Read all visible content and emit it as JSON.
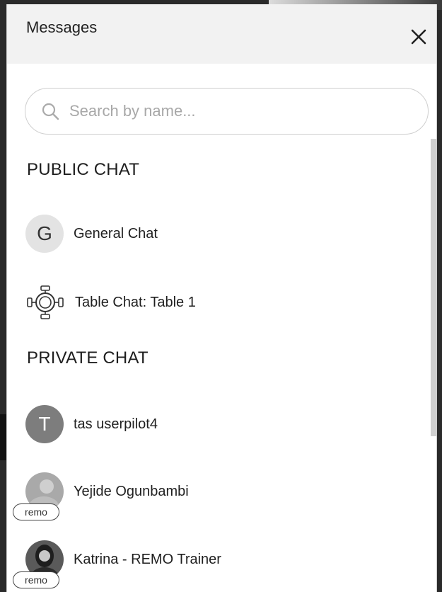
{
  "header": {
    "title": "Messages"
  },
  "search": {
    "placeholder": "Search by name..."
  },
  "public_section": {
    "title": "PUBLIC CHAT",
    "items": [
      {
        "label": "General Chat",
        "avatar_letter": "G",
        "icon": "letter-avatar"
      },
      {
        "label": "Table Chat: Table 1",
        "icon": "table-icon"
      }
    ]
  },
  "private_section": {
    "title": "PRIVATE CHAT",
    "items": [
      {
        "label": "tas userpilot4",
        "avatar_letter": "T",
        "icon": "letter-avatar"
      },
      {
        "label": "Yejide Ogunbambi",
        "icon": "photo-avatar",
        "badge": "remo"
      },
      {
        "label": "Katrina - REMO Trainer",
        "icon": "photo-avatar",
        "badge": "remo"
      }
    ]
  },
  "colors": {
    "header_bg": "#f2f2f2",
    "panel_bg": "#ffffff",
    "avatar_gray": "#7d7d7d"
  }
}
